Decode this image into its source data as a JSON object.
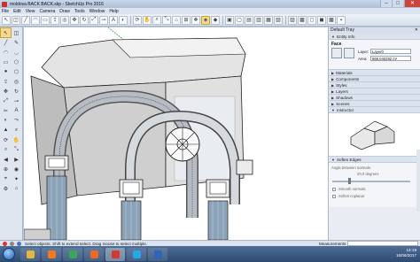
{
  "window": {
    "title": "moldova BACK BACK.skp - SketchUp Pro 2016",
    "controls": {
      "minimize": "–",
      "maximize": "□",
      "close": "✕"
    }
  },
  "menu": [
    "File",
    "Edit",
    "View",
    "Camera",
    "Draw",
    "Tools",
    "Window",
    "Help"
  ],
  "toolbar": {
    "icons": [
      "select-icon",
      "eraser-icon",
      "line-icon",
      "arc-icon",
      "rectangle-icon",
      "push-pull-icon",
      "offset-icon",
      "move-icon",
      "rotate-icon",
      "scale-icon",
      "tape-icon",
      "text-icon",
      "paint-icon",
      "orbit-icon",
      "pan-icon",
      "zoom-icon",
      "zoom-extents-icon",
      "warehouse-icon",
      "extension-icon",
      "components-icon",
      "layout-icon",
      "ruby-icon",
      "iso-view-icon",
      "top-view-icon",
      "front-view-icon",
      "right-view-icon",
      "back-view-icon",
      "left-view-icon",
      "xray-icon",
      "wireframe-icon",
      "hidden-line-icon",
      "shaded-icon",
      "textured-icon",
      "monochrome-icon"
    ],
    "active_index": 20,
    "glyphs": [
      "↖",
      "◫",
      "╱",
      "◠",
      "▭",
      "⇪",
      "◎",
      "✥",
      "↻",
      "⤢",
      "⊸",
      "A",
      "◐",
      "⟳",
      "✋",
      "⌕",
      "⤡",
      "⌂",
      "⊞",
      "❖",
      "◈",
      "◆",
      "▣",
      "▢",
      "▤",
      "▥",
      "▦",
      "▧",
      "▨",
      "▩",
      "◻",
      "◼",
      "▩",
      "▪"
    ]
  },
  "palette": {
    "glyphs": [
      "↖",
      "◫",
      "╱",
      "✎",
      "◠",
      "◡",
      "▭",
      "⬠",
      "●",
      "⬡",
      "⇪",
      "◎",
      "✥",
      "↻",
      "⤢",
      "⊸",
      "✂",
      "A",
      "◐",
      "⤳",
      "▲",
      "⌕",
      "⟳",
      "✋",
      "⌕",
      "⤡",
      "◀",
      "▶",
      "⊕",
      "◉",
      "⌖",
      "✦",
      "⚙",
      "⌂"
    ],
    "active_index": 0
  },
  "tray": {
    "title": "Default Tray",
    "close": "✕",
    "entity_info": {
      "header": "Entity Info",
      "entity_type": "Face",
      "layer_label": "Layer:",
      "layer_value": "Layer0",
      "area_label": "Area:",
      "area_value": "568.040292 m²"
    },
    "panels": [
      "Materials",
      "Components",
      "Styles",
      "Layers",
      "Shadows",
      "Scenes",
      "Instructor"
    ],
    "soften": {
      "header": "Soften Edges",
      "angle_label": "Angle between normals:",
      "angle_value": "20.0  degrees",
      "options": [
        "Smooth normals",
        "Soften coplanar"
      ]
    }
  },
  "status": {
    "message": "Select objects. Shift to extend select. Drag mouse to select multiple.",
    "measurements_label": "Measurements"
  },
  "taskbar": {
    "apps": [
      {
        "name": "explorer-icon",
        "color": "#e2b640"
      },
      {
        "name": "media-player-icon",
        "color": "#ef7a20"
      },
      {
        "name": "chrome-icon",
        "color": "#3aa757"
      },
      {
        "name": "firefox-icon",
        "color": "#e86a25"
      },
      {
        "name": "sketchup-icon",
        "color": "#d23a2f"
      },
      {
        "name": "skype-icon",
        "color": "#26a7e6"
      },
      {
        "name": "word-icon",
        "color": "#2f65b8"
      }
    ],
    "active_index": 4,
    "clock_time": "13:19",
    "clock_date": "16/06/2017"
  },
  "colors": {
    "canvas": "#ffffff",
    "accent": "#f5d98f",
    "model_gray": "#d4d4d4",
    "column_blue": "#7f9cb5"
  }
}
